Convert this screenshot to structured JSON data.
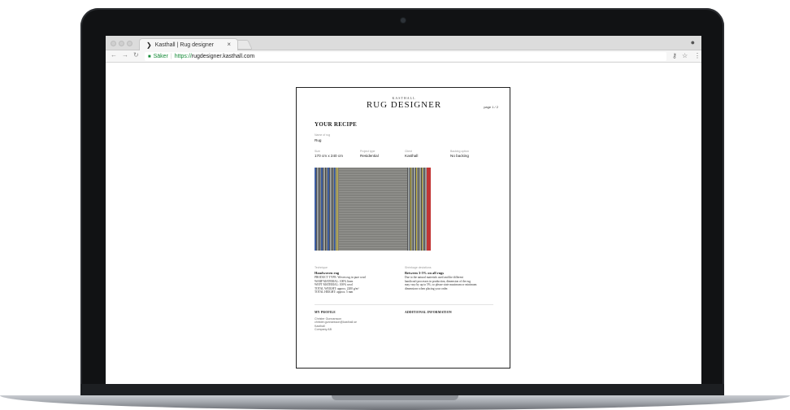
{
  "browser": {
    "tab_title": "Kasthall | Rug designer",
    "tab_close": "×",
    "secure_label": "Säker",
    "url_protocol": "https://",
    "url_host": "rugdesigner.kasthall.com",
    "icons": [
      "back-icon",
      "forward-icon",
      "reload-icon",
      "lock-icon",
      "key-icon",
      "star-icon",
      "menu-icon",
      "profile-icon"
    ]
  },
  "document": {
    "brand_small": "KASTHALL",
    "brand": "RUG DESIGNER",
    "page_indicator": "page 1 / 2",
    "title": "YOUR RECIPE",
    "name_label": "Name of rug",
    "name_value": "Rug",
    "fields": [
      {
        "label": "Size",
        "value": "170 cm x 240 cm"
      },
      {
        "label": "Project type",
        "value": "Residential"
      },
      {
        "label": "Client",
        "value": "Kasthall"
      },
      {
        "label": "Backing option",
        "value": "No backing"
      }
    ],
    "technique": {
      "label": "Technique",
      "heading": "Handwoven rug",
      "lines": [
        "PRODUCT TYPE: Woven rug in pure wool",
        "WARP MATERIAL: 100% linen",
        "WEFT MATERIAL: 100% wool",
        "TOTAL WEIGHT: approx. 2200 g/m²",
        "TOTAL HEIGHT: approx. 5 mm"
      ]
    },
    "shrinkage": {
      "label": "Shrinkage deviations",
      "heading": "Between 3-5% on all rugs",
      "lines": [
        "Due to the natural materials used and the different",
        "handicraft processes in production, dimension of the rug",
        "may vary by up to 5%, so please state maximum or minimum",
        "dimensions when placing your order."
      ]
    },
    "profile": {
      "caption": "MY PROFILE",
      "lines": [
        "Christer Gunnarsson",
        "christer.gunnarsson@kasthall.se",
        "Kasthall",
        "Company AB"
      ]
    },
    "additional": {
      "caption": "ADDITIONAL INFORMATION"
    },
    "rug_colors": {
      "base": "#8a8a86",
      "left_edge": "#3d5da0",
      "right_edge": "#c23535",
      "accent_yellow": "#c8b84a"
    }
  }
}
